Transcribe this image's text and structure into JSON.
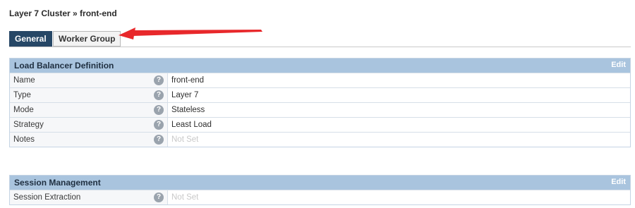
{
  "breadcrumb": "Layer 7 Cluster » front-end",
  "tabs": [
    {
      "label": "General",
      "active": true
    },
    {
      "label": "Worker Group",
      "active": false
    }
  ],
  "annotation_color": "#e8282b",
  "sections": [
    {
      "title": "Load Balancer Definition",
      "edit_label": "Edit",
      "rows": [
        {
          "label": "Name",
          "help": "?",
          "value": "front-end",
          "not_set": false
        },
        {
          "label": "Type",
          "help": "?",
          "value": "Layer 7",
          "not_set": false
        },
        {
          "label": "Mode",
          "help": "?",
          "value": "Stateless",
          "not_set": false
        },
        {
          "label": "Strategy",
          "help": "?",
          "value": "Least Load",
          "not_set": false
        },
        {
          "label": "Notes",
          "help": "?",
          "value": "Not Set",
          "not_set": true
        }
      ]
    },
    {
      "title": "Session Management",
      "edit_label": "Edit",
      "rows": [
        {
          "label": "Session Extraction",
          "help": "?",
          "value": "Not Set",
          "not_set": true
        }
      ]
    }
  ]
}
